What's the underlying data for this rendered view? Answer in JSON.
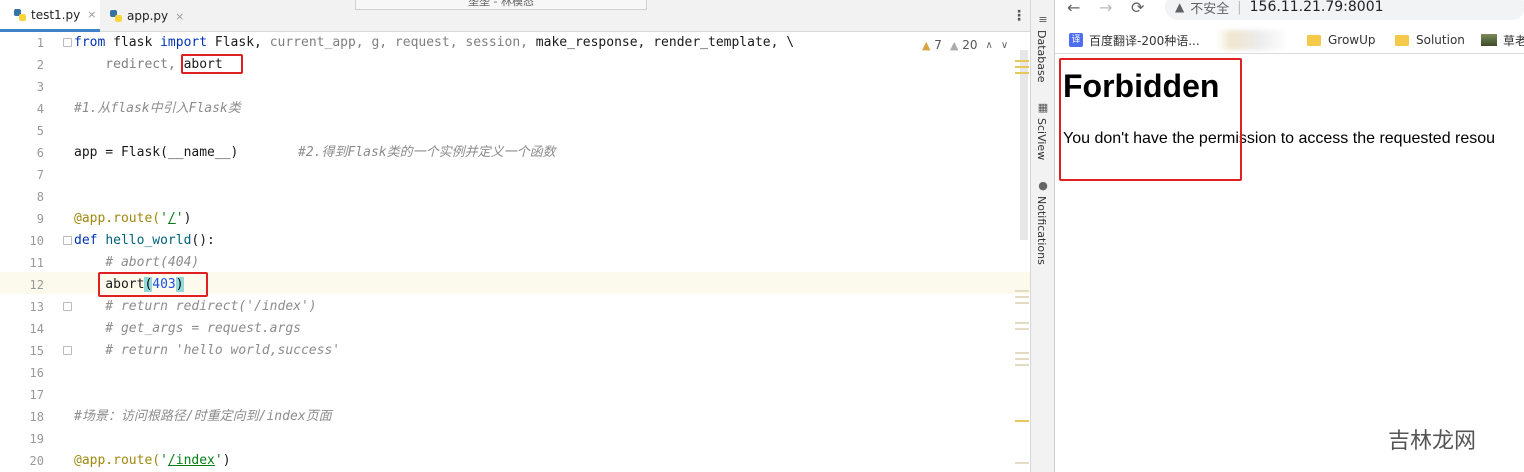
{
  "ide": {
    "window_title_fragment": "垄垄 - 林模态",
    "tabs": [
      {
        "label": "test1.py",
        "close": "×"
      },
      {
        "label": "app.py",
        "close": "×"
      }
    ],
    "menu": "⋮",
    "inspections": {
      "warnings": "7",
      "weak_warnings": "20"
    },
    "side_tools": [
      "Database",
      "SciView",
      "Notifications"
    ],
    "line_numbers": [
      "1",
      "2",
      "3",
      "4",
      "5",
      "6",
      "7",
      "8",
      "9",
      "10",
      "11",
      "12",
      "13",
      "14",
      "15",
      "16",
      "17",
      "18",
      "19",
      "20"
    ],
    "code": {
      "l1_kw1": "from",
      "l1_mod": " flask ",
      "l1_kw2": "import",
      "l1_flask": " Flask,",
      "l1_rest": " current_app, g, request, session,",
      "l1_tail": " make_response, render_template, \\",
      "l2_a": "    redirect, ",
      "l2_b": "abort",
      "l4": "#1.从flask中引入Flask类",
      "l6_code": "app = Flask(__name__)",
      "l6_comment": "#2.得到Flask类的一个实例并定义一个函数",
      "l9_deco": "@app.route(",
      "l9_q1": "'",
      "l9_slash": "/",
      "l9_q2": "'",
      "l9_close": ")",
      "l10_kw": "def",
      "l10_sp": " ",
      "l10_fn": "hello_world",
      "l10_rest": "():",
      "l11": "    # abort(404)",
      "l12_a": "    abort",
      "l12_p1": "(",
      "l12_num": "403",
      "l12_p2": ")",
      "l13": "    # return redirect('/index')",
      "l14": "    # get_args = request.args",
      "l15": "    # return 'hello world,success'",
      "l18": "#场景：访问根路径/时重定向到/index页面",
      "l20_deco": "@app.route(",
      "l20_q1": "'",
      "l20_path": "/index",
      "l20_q2": "'",
      "l20_close": ")"
    }
  },
  "browser": {
    "nav": {
      "back": "←",
      "forward": "→",
      "reload": "⟳"
    },
    "security_label": "不安全",
    "url": "156.11.21.79:8001",
    "bookmarks": [
      {
        "icon": "译",
        "label": "百度翻译-200种语..."
      },
      {
        "label": "GrowUp"
      },
      {
        "label": "Solution"
      },
      {
        "label": "草老"
      }
    ],
    "page": {
      "heading": "Forbidden",
      "message": "You don't have the permission to access the requested resou"
    }
  },
  "watermark": "吉林龙网",
  "colors": {
    "highlight_box": "#e02020",
    "keyword": "#0033b3",
    "comment": "#8c8c8c",
    "string": "#067d17",
    "decorator": "#9e880d",
    "number": "#1750eb"
  }
}
